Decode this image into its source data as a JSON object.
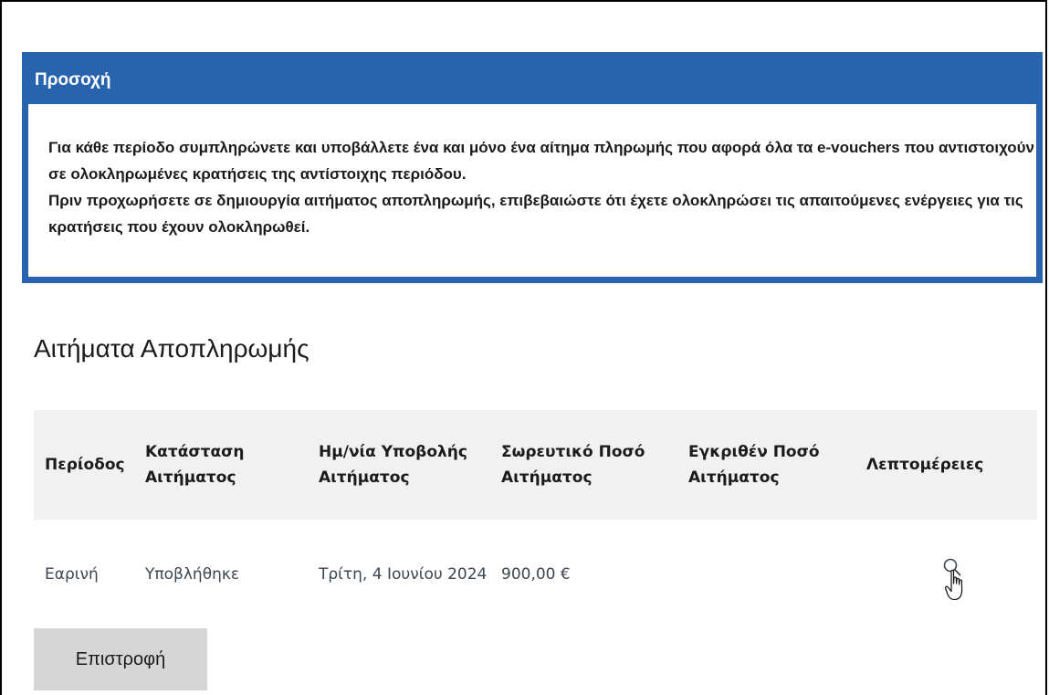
{
  "notice": {
    "title": "Προσοχή",
    "line1": "Για κάθε περίοδο συμπληρώνετε και υποβάλλετε ένα και μόνο ένα αίτημα πληρωμής που αφορά όλα τα e-vouchers που αντιστοιχούν σε ολοκληρωμένες κρατήσεις της αντίστοιχης περιόδου.",
    "line2": "Πριν προχωρήσετε σε δημιουργία αιτήματος αποπληρωμής, επιβεβαιώστε ότι έχετε ολοκληρώσει τις απαιτούμενες ενέργειες για τις κρατήσεις που έχουν ολοκληρωθεί."
  },
  "section": {
    "title": "Αιτήματα Αποπληρωμής"
  },
  "table": {
    "headers": {
      "period": "Περίοδος",
      "status": "Κατάσταση Αιτήματος",
      "date": "Ημ/νία Υποβολής Αιτήματος",
      "sum": "Σωρευτικό Ποσό Αιτήματος",
      "approved": "Εγκριθέν Ποσό Αιτήματος",
      "details": "Λεπτομέρειες"
    },
    "rows": [
      {
        "period": "Εαρινή",
        "status": "Υποβλήθηκε",
        "date": "Τρίτη, 4 Ιουνίου 2024",
        "sum": "900,00 €",
        "approved": "",
        "details_icon": "search-icon"
      }
    ]
  },
  "actions": {
    "back_label": "Επιστροφή"
  },
  "colors": {
    "notice_accent": "#2864ad",
    "header_row_bg": "#f1f1f1",
    "button_bg": "#d6d6d6"
  }
}
